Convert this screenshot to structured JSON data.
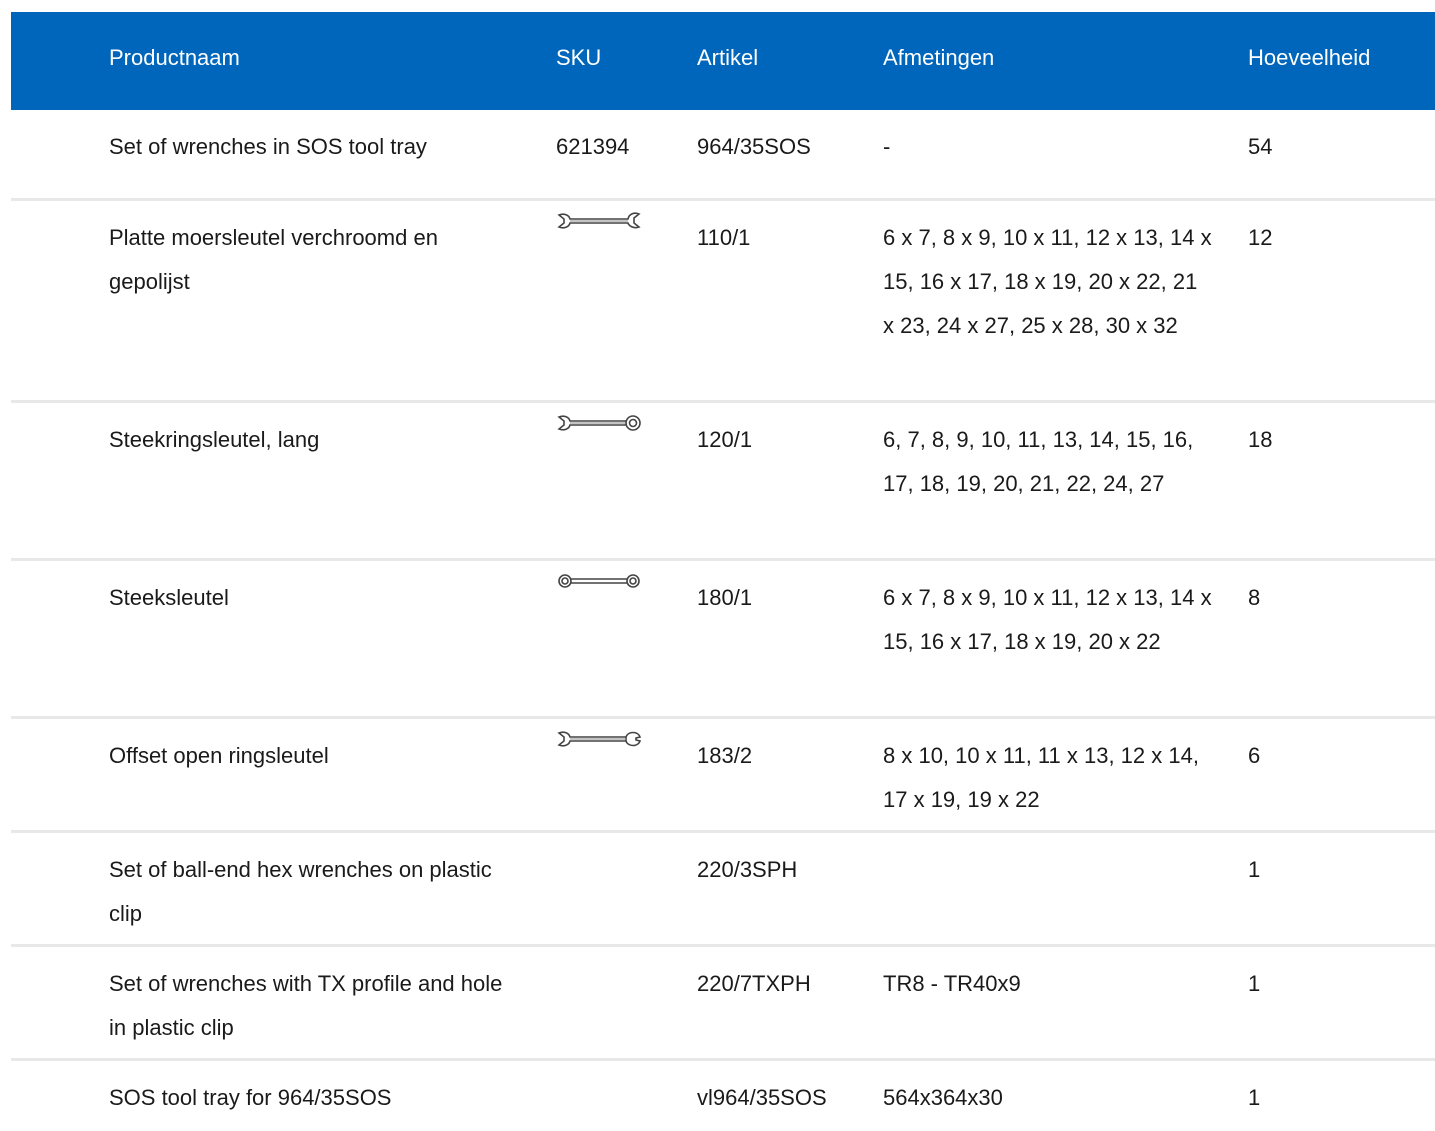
{
  "table": {
    "headers": {
      "name": "Productnaam",
      "sku": "SKU",
      "article": "Artikel",
      "dimensions": "Afmetingen",
      "quantity": "Hoeveelheid"
    },
    "rows": [
      {
        "name": "Set of wrenches in SOS tool tray",
        "sku": "621394",
        "sku_icon": "",
        "article": "964/35SOS",
        "dimensions": "-",
        "quantity": "54"
      },
      {
        "name": "Platte moersleutel verchroomd en gepolijst",
        "sku": "",
        "sku_icon": "open-end-wrench-icon",
        "article": "110/1",
        "dimensions": "6 x 7, 8 x 9, 10 x 11, 12 x 13, 14 x 15, 16 x 17, 18 x 19, 20 x 22, 21 x 23, 24 x 27, 25 x 28, 30 x 32",
        "quantity": "12"
      },
      {
        "name": "Steekringsleutel, lang",
        "sku": "",
        "sku_icon": "combination-wrench-icon",
        "article": "120/1",
        "dimensions": "6, 7, 8, 9, 10, 11, 13, 14, 15, 16, 17, 18, 19, 20, 21, 22, 24, 27",
        "quantity": "18"
      },
      {
        "name": "Steeksleutel",
        "sku": "",
        "sku_icon": "ring-wrench-icon",
        "article": "180/1",
        "dimensions": "6 x 7, 8 x 9, 10 x 11, 12 x 13, 14 x 15, 16 x 17, 18 x 19, 20 x 22",
        "quantity": "8"
      },
      {
        "name": "Offset open ringsleutel",
        "sku": "",
        "sku_icon": "flare-nut-wrench-icon",
        "article": "183/2",
        "dimensions": "8 x 10, 10 x 11, 11 x 13, 12 x 14, 17 x 19, 19 x 22",
        "quantity": "6"
      },
      {
        "name": "Set of ball-end hex wrenches on plastic clip",
        "sku": "",
        "sku_icon": "",
        "article": "220/3SPH",
        "dimensions": "",
        "quantity": "1"
      },
      {
        "name": "Set of wrenches with TX profile and hole in plastic clip",
        "sku": "",
        "sku_icon": "",
        "article": "220/7TXPH",
        "dimensions": "TR8 - TR40x9",
        "quantity": "1"
      },
      {
        "name": "SOS tool tray for 964/35SOS",
        "sku": "",
        "sku_icon": "",
        "article": "vl964/35SOS",
        "dimensions": "564x364x30",
        "quantity": "1"
      }
    ]
  },
  "colors": {
    "header_bg": "#0066bb",
    "header_text": "#ffffff",
    "row_divider": "#e8e8e8"
  }
}
